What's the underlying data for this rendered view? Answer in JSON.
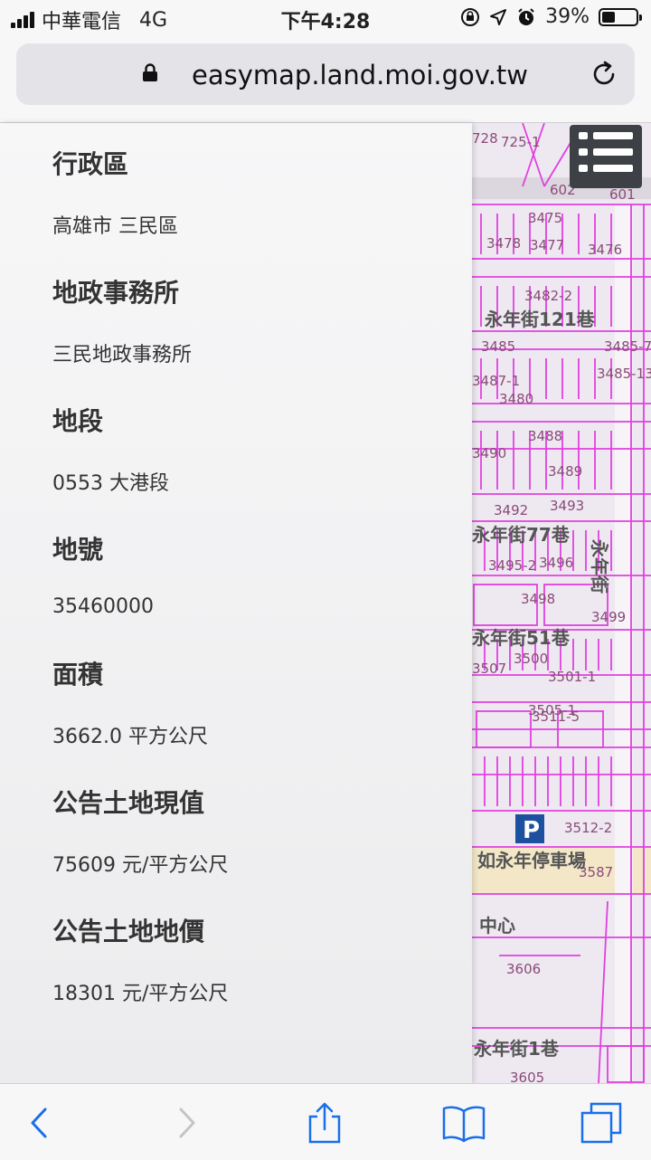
{
  "status_bar": {
    "carrier": "中華電信",
    "network": "4G",
    "time": "下午4:28",
    "battery": "39%",
    "battery_level": 0.39
  },
  "browser": {
    "host": "easymap.land.moi.gov.tw"
  },
  "panel": {
    "fields": [
      {
        "label": "行政區",
        "value": "高雄市 三民區"
      },
      {
        "label": "地政事務所",
        "value": "三民地政事務所"
      },
      {
        "label": "地段",
        "value": "0553 大港段"
      },
      {
        "label": "地號",
        "value": "35460000"
      },
      {
        "label": "面積",
        "value": "3662.0 平方公尺"
      },
      {
        "label": "公告土地現值",
        "value": "75609 元/平方公尺"
      },
      {
        "label": "公告土地地價",
        "value": "18301 元/平方公尺"
      }
    ]
  },
  "map": {
    "parcel_labels": [
      "728",
      "725-1",
      "602",
      "601",
      "3475",
      "3478",
      "3477",
      "3476",
      "3482-2",
      "3485",
      "3485-7",
      "3485-13",
      "3487-1",
      "3480",
      "3488",
      "3489",
      "3490",
      "3492",
      "3493",
      "3495-2",
      "3496",
      "3498",
      "3499",
      "3500",
      "3501-1",
      "3505-1",
      "3507",
      "3511-5",
      "3512-2",
      "3587",
      "3606",
      "3605"
    ],
    "road_labels": [
      "永年街121巷",
      "永年街77巷",
      "永年街51巷",
      "永年街",
      "如永年停車場",
      "永年街1巷",
      "中心"
    ],
    "colors": {
      "parcel_line": "#e040e0",
      "background": "#eee9f1",
      "parking": "#1e50a0"
    }
  }
}
